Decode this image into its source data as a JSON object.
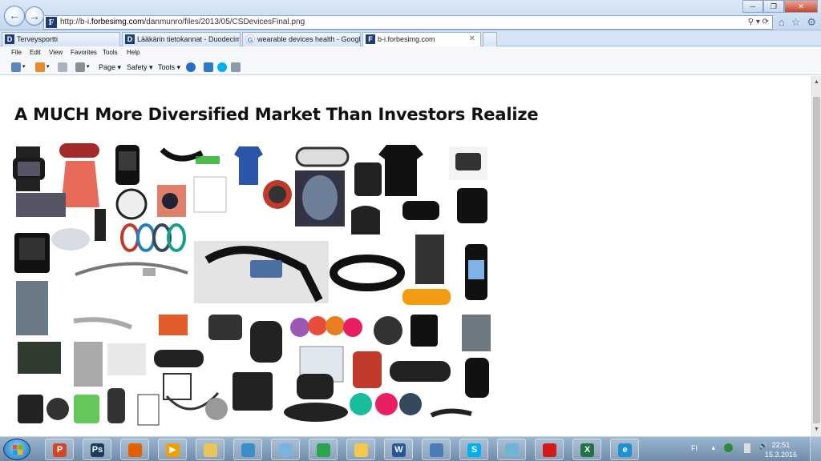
{
  "browser": {
    "url_prefix": "http://b-i.",
    "url_domain": "forbesimg.com",
    "url_path": "/danmunro/files/2013/05/CSDevicesFinal.png",
    "favicon_letter": "F"
  },
  "tabs": [
    {
      "label": "Terveysportti",
      "icon": "D"
    },
    {
      "label": "Lääkärin tietokannat - Duodecim",
      "icon": "D"
    },
    {
      "label": "wearable devices health - Google-haku",
      "icon": "G"
    },
    {
      "label": "b-i.forbesimg.com",
      "icon": "F",
      "close": "✕"
    }
  ],
  "menu": [
    "File",
    "Edit",
    "View",
    "Favorites",
    "Tools",
    "Help"
  ],
  "commandbar": {
    "page": "Page ▾",
    "safety": "Safety ▾",
    "tools": "Tools ▾"
  },
  "content": {
    "title": "A MUCH More Diversified Market Than Investors Realize"
  },
  "taskbar": {
    "apps": [
      {
        "name": "powerpoint",
        "glyph": "P",
        "color": "#d24726"
      },
      {
        "name": "photoshop",
        "glyph": "Ps",
        "color": "#1c3b5e"
      },
      {
        "name": "firefox",
        "glyph": "",
        "color": "#e66000"
      },
      {
        "name": "media-player",
        "glyph": "▶",
        "color": "#f0a000"
      },
      {
        "name": "explorer",
        "glyph": "",
        "color": "#e8c45a"
      },
      {
        "name": "chart-app",
        "glyph": "",
        "color": "#3b8ec6"
      },
      {
        "name": "paint",
        "glyph": "",
        "color": "#7bb3e0"
      },
      {
        "name": "chrome",
        "glyph": "",
        "color": "#2aa44f"
      },
      {
        "name": "outlook-app",
        "glyph": "",
        "color": "#f2c94c"
      },
      {
        "name": "word",
        "glyph": "W",
        "color": "#2b579a"
      },
      {
        "name": "network-app",
        "glyph": "",
        "color": "#4a7eb8"
      },
      {
        "name": "skype",
        "glyph": "S",
        "color": "#00aff0"
      },
      {
        "name": "notepad",
        "glyph": "",
        "color": "#6fb6d4"
      },
      {
        "name": "acrobat",
        "glyph": "",
        "color": "#d21a1a"
      },
      {
        "name": "excel",
        "glyph": "X",
        "color": "#217346"
      },
      {
        "name": "internet-explorer",
        "glyph": "e",
        "color": "#1e90d6"
      }
    ],
    "language": "FI",
    "time": "22:51",
    "date": "15.3.2016"
  }
}
